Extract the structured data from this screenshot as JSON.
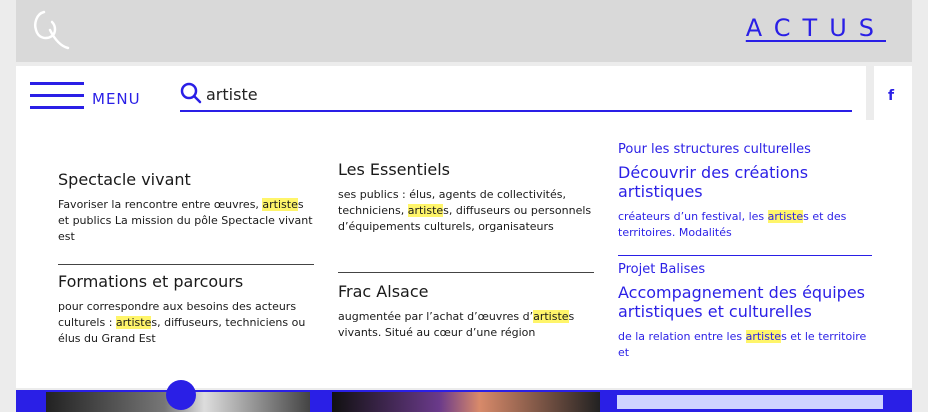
{
  "header": {
    "actus_label": "ACTUS"
  },
  "menu": {
    "label": "MENU"
  },
  "search": {
    "value": "artiste",
    "placeholder": ""
  },
  "social": {
    "facebook": "f"
  },
  "results_col1": [
    {
      "title": "Spectacle vivant",
      "snippet_pre": "Favoriser la rencontre entre œuvres, ",
      "snippet_hl": "artiste",
      "snippet_post": "s et publics La mission du pôle Spectacle vivant est"
    },
    {
      "title": "Formations et parcours",
      "snippet_pre": "pour correspondre aux besoins des acteurs culturels : ",
      "snippet_hl": "artiste",
      "snippet_post": "s, diffuseurs, techniciens ou élus du Grand Est"
    }
  ],
  "results_col2": [
    {
      "title": "Les Essentiels",
      "snippet_pre": "ses publics : élus, agents de collectivités, techniciens, ",
      "snippet_hl": "artiste",
      "snippet_post": "s, diffuseurs ou personnels d’équipements culturels, organisateurs"
    },
    {
      "title": "Frac Alsace",
      "snippet_pre": "augmentée par l’achat d’œuvres d’",
      "snippet_hl": "artiste",
      "snippet_post": "s vivants. Situé au cœur d’une région"
    }
  ],
  "results_col3": [
    {
      "category": "Pour les structures culturelles",
      "title": "Découvrir des créations artistiques",
      "snippet_pre": "créateurs d’un festival, les ",
      "snippet_hl": "artiste",
      "snippet_post": "s et des territoires. Modalités"
    },
    {
      "category": "Projet Balises",
      "title": "Accompagnement des équipes artistiques et culturelles",
      "snippet_pre": "de la relation entre les ",
      "snippet_hl": "artiste",
      "snippet_post": "s et le territoire et"
    }
  ],
  "colors": {
    "accent": "#2a1fe6",
    "highlight": "#fff56a",
    "topbar": "#d9d9d9"
  }
}
